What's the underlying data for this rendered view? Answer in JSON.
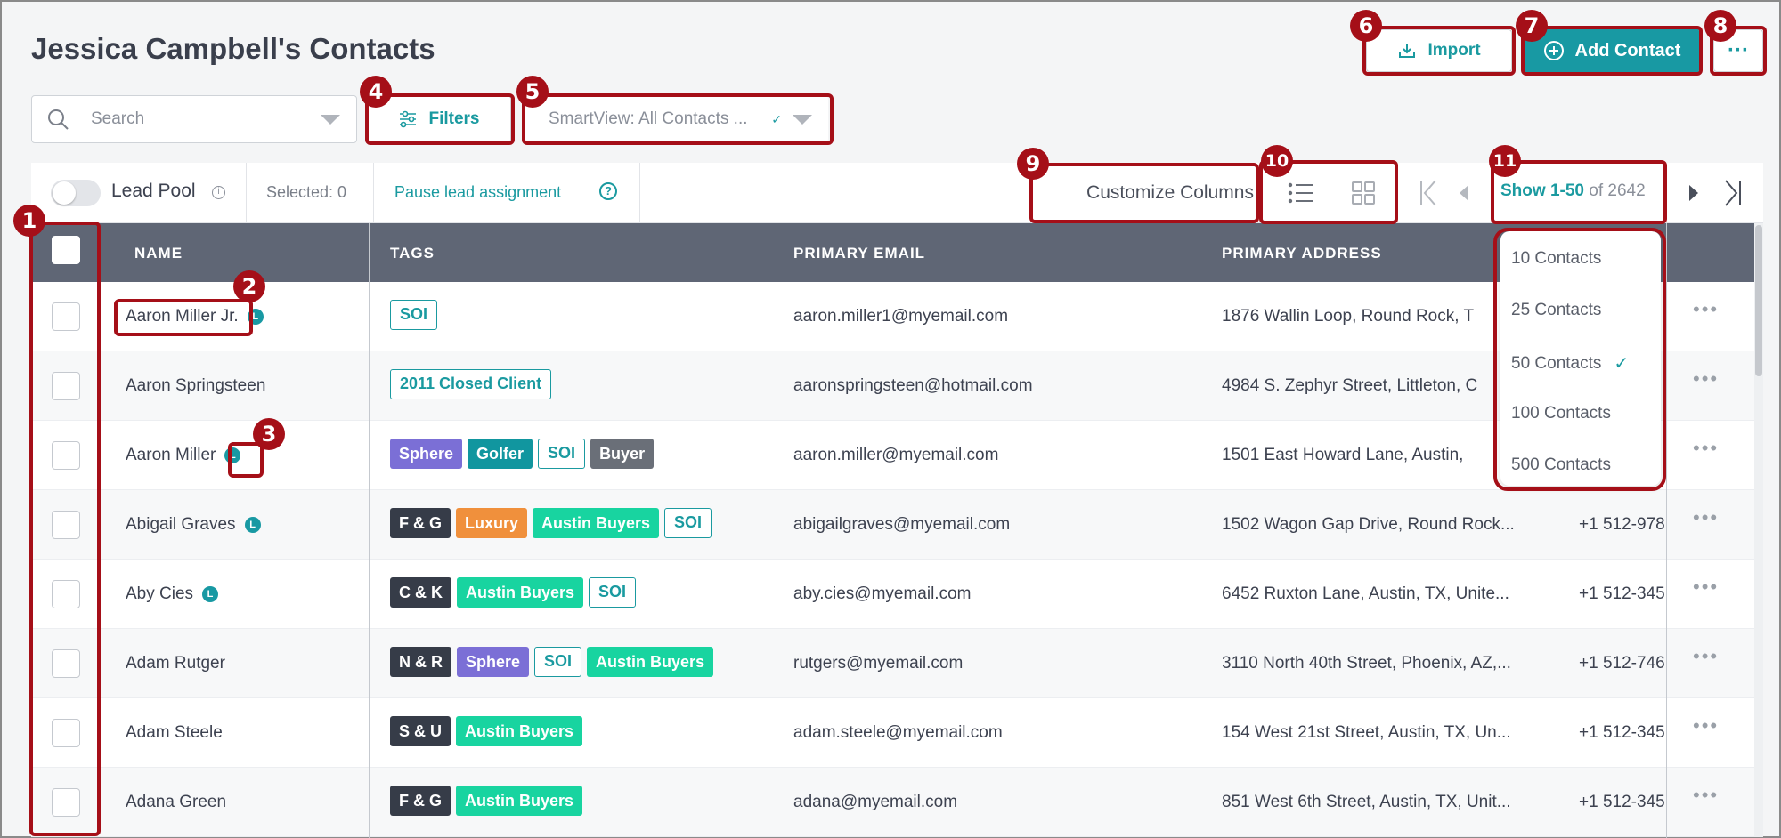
{
  "page": {
    "title": "Jessica Campbell's Contacts"
  },
  "header": {
    "import_label": "Import",
    "add_contact_label": "Add Contact",
    "more_label": "···"
  },
  "search": {
    "placeholder": "Search"
  },
  "filters": {
    "label": "Filters"
  },
  "smartview": {
    "value": "SmartView: All Contacts ..."
  },
  "toolbar": {
    "lead_pool_label": "Lead Pool",
    "selected_label": "Selected: 0",
    "pause_label": "Pause lead assignment",
    "customize_label": "Customize Columns",
    "show_range": "Show 1-50",
    "show_total": "of 2642"
  },
  "table": {
    "headers": [
      "NAME",
      "TAGS",
      "PRIMARY EMAIL",
      "PRIMARY ADDRESS"
    ],
    "rows": [
      {
        "name": "Aaron Miller Jr.",
        "badge": "L",
        "tags": [
          {
            "t": "SOI",
            "s": "outline"
          }
        ],
        "email": "aaron.miller1@myemail.com",
        "address": "1876 Wallin Loop, Round Rock, T",
        "phone": ""
      },
      {
        "name": "Aaron Springsteen",
        "badge": "",
        "tags": [
          {
            "t": "2011 Closed Client",
            "s": "outline"
          }
        ],
        "email": "aaronspringsteen@hotmail.com",
        "address": "4984 S. Zephyr Street, Littleton, C",
        "phone": ""
      },
      {
        "name": "Aaron Miller",
        "badge": "L",
        "tags": [
          {
            "t": "Sphere",
            "s": "purple"
          },
          {
            "t": "Golfer",
            "s": "teal"
          },
          {
            "t": "SOI",
            "s": "outline"
          },
          {
            "t": "Buyer",
            "s": "gray"
          }
        ],
        "email": "aaron.miller@myemail.com",
        "address": "1501 East Howard Lane, Austin,",
        "phone": ""
      },
      {
        "name": "Abigail Graves",
        "badge": "L",
        "tags": [
          {
            "t": "F & G",
            "s": "dark"
          },
          {
            "t": "Luxury",
            "s": "orange"
          },
          {
            "t": "Austin Buyers",
            "s": "green"
          },
          {
            "t": "SOI",
            "s": "outline"
          }
        ],
        "email": "abigailgraves@myemail.com",
        "address": "1502 Wagon Gap Drive, Round Rock...",
        "phone": "+1 512-978"
      },
      {
        "name": "Aby Cies",
        "badge": "L",
        "tags": [
          {
            "t": "C & K",
            "s": "dark"
          },
          {
            "t": "Austin Buyers",
            "s": "green"
          },
          {
            "t": "SOI",
            "s": "outline"
          }
        ],
        "email": "aby.cies@myemail.com",
        "address": "6452 Ruxton Lane, Austin, TX, Unite...",
        "phone": "+1 512-345"
      },
      {
        "name": "Adam Rutger",
        "badge": "",
        "tags": [
          {
            "t": "N & R",
            "s": "dark"
          },
          {
            "t": "Sphere",
            "s": "purple"
          },
          {
            "t": "SOI",
            "s": "outline"
          },
          {
            "t": "Austin Buyers",
            "s": "green"
          }
        ],
        "email": "rutgers@myemail.com",
        "address": "3110 North 40th Street, Phoenix, AZ,...",
        "phone": "+1 512-746"
      },
      {
        "name": "Adam Steele",
        "badge": "",
        "tags": [
          {
            "t": "S & U",
            "s": "dark"
          },
          {
            "t": "Austin Buyers",
            "s": "green"
          }
        ],
        "email": "adam.steele@myemail.com",
        "address": "154 West 21st Street, Austin, TX, Un...",
        "phone": "+1 512-345"
      },
      {
        "name": "Adana Green",
        "badge": "",
        "tags": [
          {
            "t": "F & G",
            "s": "dark"
          },
          {
            "t": "Austin Buyers",
            "s": "green"
          }
        ],
        "email": "adana@myemail.com",
        "address": "851 West 6th Street, Austin, TX, Unit...",
        "phone": "+1 512-345"
      }
    ]
  },
  "page_size_menu": {
    "options": [
      "10 Contacts",
      "25 Contacts",
      "50 Contacts",
      "100 Contacts",
      "500 Contacts"
    ],
    "selected": "50 Contacts"
  },
  "annotations": [
    "1",
    "2",
    "3",
    "4",
    "5",
    "6",
    "7",
    "8",
    "9",
    "10",
    "11"
  ],
  "colors": {
    "accent": "#1899a3",
    "annotation": "#a50f18",
    "header_bg": "#5f6675"
  }
}
